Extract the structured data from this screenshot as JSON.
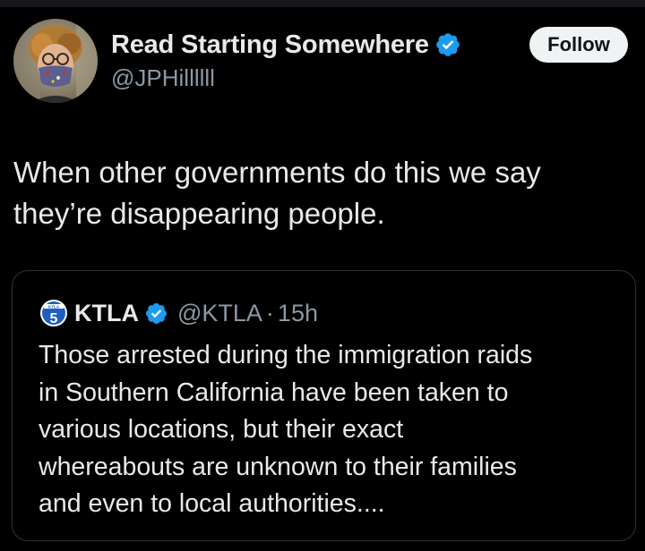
{
  "author": {
    "display_name": "Read Starting Somewhere",
    "handle": "@JPHillllll",
    "verified": true
  },
  "follow_button": {
    "label": "Follow"
  },
  "tweet": {
    "lines": [
      "When other governments do this we say",
      "they’re disappearing people."
    ]
  },
  "quote": {
    "display_name": "KTLA",
    "handle": "@KTLA",
    "separator": "·",
    "time": "15h",
    "verified": true,
    "lines": [
      "Those arrested during the immigration raids",
      "in Southern California have been taken to",
      "various locations, but their exact",
      "whereabouts are unknown to their families",
      "and even to local authorities...."
    ]
  },
  "icons": {
    "verified": "verified-badge-icon",
    "ktla_logo": "ktla-5-logo-icon"
  },
  "colors": {
    "background": "#000000",
    "text_primary": "#e7e9ea",
    "text_secondary": "#8b98a5",
    "verified_blue": "#1d9bf0",
    "follow_button_bg": "#eff3f4",
    "border": "#2f3336"
  }
}
